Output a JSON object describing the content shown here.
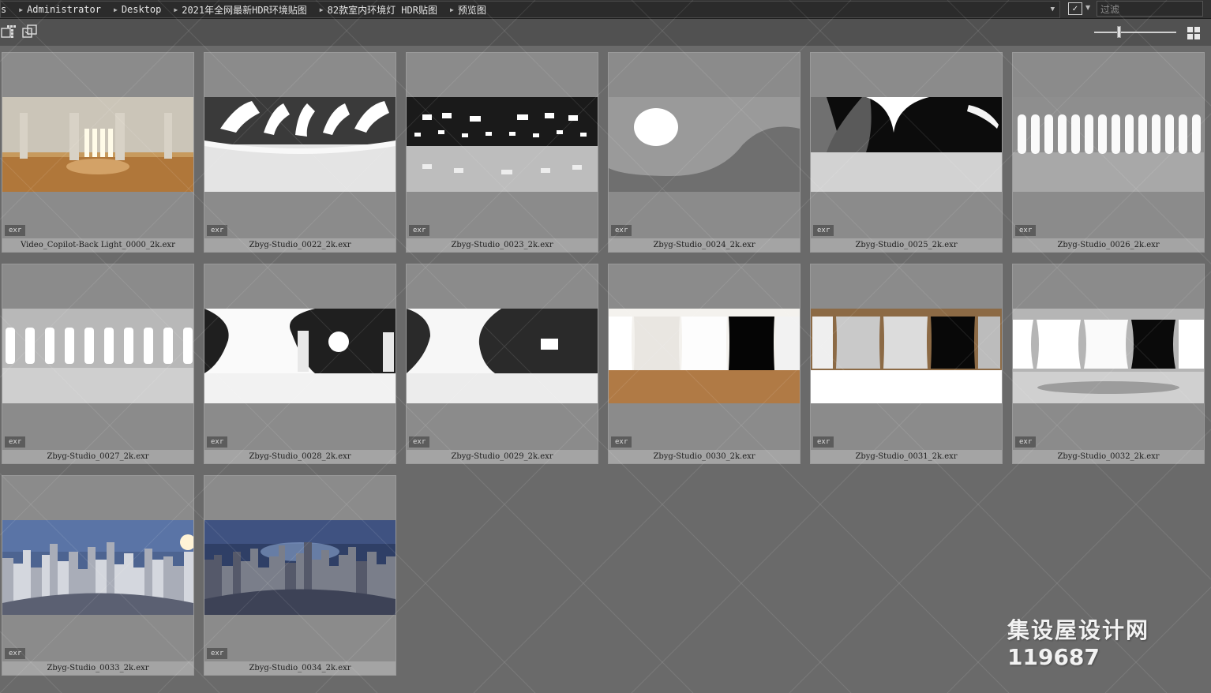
{
  "breadcrumbs": [
    "s",
    "Administrator",
    "Desktop",
    "2021年全网最新HDR环境贴图",
    "82款室内环境灯 HDR贴图",
    "预览图"
  ],
  "filter": {
    "placeholder": "过滤"
  },
  "toolbar": {
    "icons": [
      "thumbnail-grid-icon",
      "thumbnail-refresh-icon"
    ],
    "zoom_level": 0.3,
    "view_icon": "grid-view-icon"
  },
  "files": [
    {
      "name": "Video_Copilot-Back Light_0000_2k.exr",
      "type": "exr"
    },
    {
      "name": "Zbyg-Studio_0022_2k.exr",
      "type": "exr"
    },
    {
      "name": "Zbyg-Studio_0023_2k.exr",
      "type": "exr"
    },
    {
      "name": "Zbyg-Studio_0024_2k.exr",
      "type": "exr"
    },
    {
      "name": "Zbyg-Studio_0025_2k.exr",
      "type": "exr"
    },
    {
      "name": "Zbyg-Studio_0026_2k.exr",
      "type": "exr"
    },
    {
      "name": "Zbyg-Studio_0027_2k.exr",
      "type": "exr"
    },
    {
      "name": "Zbyg-Studio_0028_2k.exr",
      "type": "exr"
    },
    {
      "name": "Zbyg-Studio_0029_2k.exr",
      "type": "exr"
    },
    {
      "name": "Zbyg-Studio_0030_2k.exr",
      "type": "exr"
    },
    {
      "name": "Zbyg-Studio_0031_2k.exr",
      "type": "exr"
    },
    {
      "name": "Zbyg-Studio_0032_2k.exr",
      "type": "exr"
    },
    {
      "name": "Zbyg-Studio_0033_2k.exr",
      "type": "exr"
    },
    {
      "name": "Zbyg-Studio_0034_2k.exr",
      "type": "exr"
    }
  ],
  "watermark": {
    "brand": "集设屋设计网",
    "id": "119687"
  }
}
